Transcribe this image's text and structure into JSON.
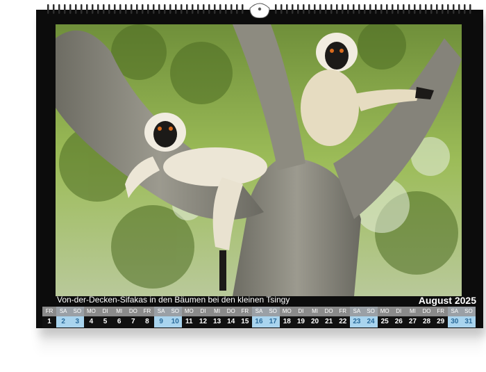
{
  "calendar": {
    "caption": "Von-der-Decken-Sifakas in den Bäumen bei den kleinen Tsingy",
    "month": "August 2025",
    "weekdays": [
      "FR",
      "SA",
      "SO",
      "MO",
      "DI",
      "MI",
      "DO",
      "FR",
      "SA",
      "SO",
      "MO",
      "DI",
      "MI",
      "DO",
      "FR",
      "SA",
      "SO",
      "MO",
      "DI",
      "MI",
      "DO",
      "FR",
      "SA",
      "SO",
      "MO",
      "DI",
      "MI",
      "DO",
      "FR",
      "SA",
      "SO"
    ],
    "days": [
      "1",
      "2",
      "3",
      "4",
      "5",
      "6",
      "7",
      "8",
      "9",
      "10",
      "11",
      "12",
      "13",
      "14",
      "15",
      "16",
      "17",
      "18",
      "19",
      "20",
      "21",
      "22",
      "23",
      "24",
      "25",
      "26",
      "27",
      "28",
      "29",
      "30",
      "31"
    ]
  }
}
